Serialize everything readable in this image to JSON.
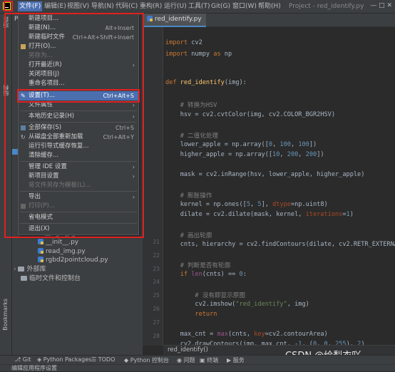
{
  "menubar": {
    "items": [
      "文件(F)",
      "编辑(E)",
      "视图(V)",
      "导航(N)",
      "代码(C)",
      "重构(R)",
      "运行(U)",
      "工具(T)",
      "Git(G)",
      "窗口(W)",
      "帮助(H)"
    ],
    "window_title": "Project - red_identify.py",
    "window_controls": "—  □  ✕"
  },
  "project": {
    "header": "Proje",
    "tree": [
      {
        "label": "rgb.jpg",
        "kind": "image"
      },
      {
        "label": "__init__.py",
        "kind": "py"
      },
      {
        "label": "read_img.py",
        "kind": "py"
      },
      {
        "label": "rgbd2pointcloud.py",
        "kind": "py"
      },
      {
        "label": "外部库",
        "kind": "lib"
      },
      {
        "label": "临时文件和控制台",
        "kind": "scratch"
      }
    ]
  },
  "left_stripe": {
    "project": "项目",
    "structure": "结构",
    "bookmarks": "Bookmarks"
  },
  "editor": {
    "tab": "red_identify.py",
    "line_numbers": [
      "21",
      "22",
      "23",
      "24",
      "25",
      "26",
      "27",
      "28"
    ],
    "breadcrumb": "red_identify()"
  },
  "file_menu": {
    "items": [
      {
        "label": "新建项目...",
        "shortcut": "",
        "arrow": false,
        "disabled": false
      },
      {
        "label": "新建(N)...",
        "shortcut": "Alt+Insert",
        "arrow": false,
        "disabled": false
      },
      {
        "label": "新建临时文件",
        "shortcut": "Ctrl+Alt+Shift+Insert",
        "arrow": false,
        "disabled": false
      },
      {
        "label": "打开(O)...",
        "shortcut": "",
        "arrow": false,
        "disabled": false
      },
      {
        "label": "另存为...",
        "shortcut": "",
        "arrow": false,
        "disabled": true
      },
      {
        "label": "打开最近(R)",
        "shortcut": "",
        "arrow": true,
        "disabled": false
      },
      {
        "label": "关闭项目(J)",
        "shortcut": "",
        "arrow": false,
        "disabled": false
      },
      {
        "label": "重命名项目...",
        "shortcut": "",
        "arrow": false,
        "disabled": false
      },
      {
        "label": "设置(T)...",
        "shortcut": "Ctrl+Alt+S",
        "arrow": false,
        "disabled": false,
        "highlighted": true
      },
      {
        "label": "文件属性",
        "shortcut": "",
        "arrow": true,
        "disabled": false
      },
      {
        "label": "本地历史记录(H)",
        "shortcut": "",
        "arrow": true,
        "disabled": false
      },
      {
        "label": "全部保存(S)",
        "shortcut": "Ctrl+S",
        "arrow": false,
        "disabled": false
      },
      {
        "label": "从磁盘全部重新加载",
        "shortcut": "Ctrl+Alt+Y",
        "arrow": false,
        "disabled": false
      },
      {
        "label": "运行引导式缓存恢复...",
        "shortcut": "",
        "arrow": false,
        "disabled": false
      },
      {
        "label": "清除缓存...",
        "shortcut": "",
        "arrow": false,
        "disabled": false
      },
      {
        "label": "管理 IDE 设置",
        "shortcut": "",
        "arrow": true,
        "disabled": false
      },
      {
        "label": "新项目设置",
        "shortcut": "",
        "arrow": true,
        "disabled": false
      },
      {
        "label": "将文件另存为模板(L)...",
        "shortcut": "",
        "arrow": false,
        "disabled": true
      },
      {
        "label": "导出",
        "shortcut": "",
        "arrow": true,
        "disabled": false
      },
      {
        "label": "打印(P)...",
        "shortcut": "",
        "arrow": false,
        "disabled": true
      },
      {
        "label": "省电模式",
        "shortcut": "",
        "arrow": false,
        "disabled": false
      },
      {
        "label": "退出(X)",
        "shortcut": "",
        "arrow": false,
        "disabled": false
      }
    ]
  },
  "bottom_toolbar": {
    "items": [
      "Git",
      "Python Packages",
      "TODO",
      "Python 控制台",
      "问题",
      "终端",
      "服务"
    ]
  },
  "statusbar": {
    "text": "编辑应用程序设置"
  },
  "watermark": "CSDN @绘梨衣吖"
}
